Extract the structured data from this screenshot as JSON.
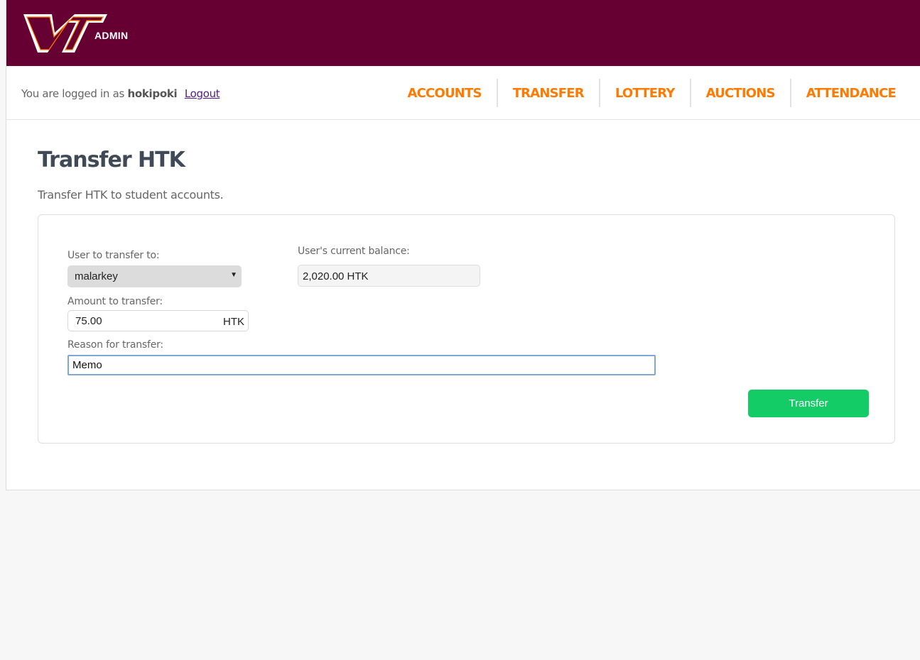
{
  "header": {
    "logo": "VT",
    "admin_label": "ADMIN"
  },
  "session": {
    "logged_in_prefix": "You are logged in as",
    "username": "hokipoki",
    "logout_label": "Logout"
  },
  "nav": {
    "items": [
      {
        "label": "ACCOUNTS"
      },
      {
        "label": "TRANSFER"
      },
      {
        "label": "LOTTERY"
      },
      {
        "label": "AUCTIONS"
      },
      {
        "label": "ATTENDANCE"
      }
    ]
  },
  "page": {
    "title": "Transfer HTK",
    "subtitle": "Transfer HTK to student accounts."
  },
  "form": {
    "user_label": "User to transfer to:",
    "user_selected": "malarkey",
    "balance_label": "User's current balance:",
    "balance_value": "2,020.00 HTK",
    "amount_label": "Amount to transfer:",
    "amount_value": "75.00",
    "amount_unit": "HTK",
    "reason_label": "Reason for transfer:",
    "reason_value": "Memo",
    "submit_label": "Transfer"
  },
  "colors": {
    "brand_maroon": "#660033",
    "nav_orange": "#ff7a00",
    "button_green": "#13cc66"
  }
}
